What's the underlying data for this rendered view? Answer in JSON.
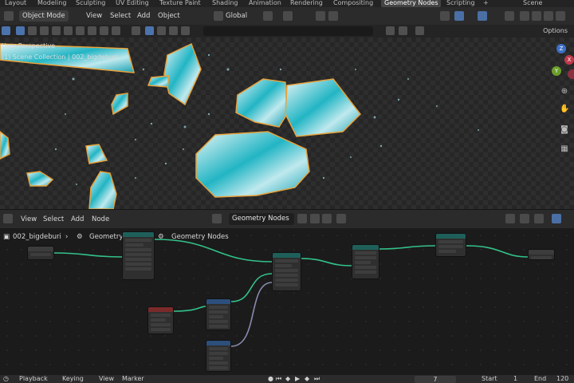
{
  "workspace_tabs": [
    "Layout",
    "Modeling",
    "Sculpting",
    "UV Editing",
    "Texture Paint",
    "Shading",
    "Animation",
    "Rendering",
    "Compositing",
    "Geometry Nodes",
    "Scripting",
    "+"
  ],
  "active_tab": "Geometry Nodes",
  "scene_name": "Scene",
  "viewport_header": {
    "mode": "Object Mode",
    "menus": [
      "View",
      "Select",
      "Add",
      "Object"
    ],
    "transform_orientation": "Global"
  },
  "viewport_toolbar": {
    "options_label": "Options"
  },
  "viewport": {
    "view_label": "User Perspective",
    "collection_label": "(1) Scene Collection | 002_bigdeburi",
    "axes": {
      "x": "X",
      "y": "Y",
      "z": "Z"
    }
  },
  "node_editor_header": {
    "menus": [
      "View",
      "Select",
      "Add",
      "Node"
    ],
    "editor_type": "Geometry Nodes",
    "node_tree_name": "Geometry Nodes"
  },
  "breadcrumb": [
    "002_bigdeburi",
    "GeometryNodes",
    "Geometry Nodes"
  ],
  "timeline": {
    "menus": [
      "Playback",
      "Keying",
      "View",
      "Marker"
    ],
    "current_frame": "7",
    "start_label": "Start",
    "start_value": "1",
    "end_label": "End",
    "end_value": "120"
  },
  "colors": {
    "accent": "#4b73ad",
    "selection_outline": "#e8a23c",
    "mesh_cyan": "#22b5c4",
    "link_green": "#33c28a"
  }
}
